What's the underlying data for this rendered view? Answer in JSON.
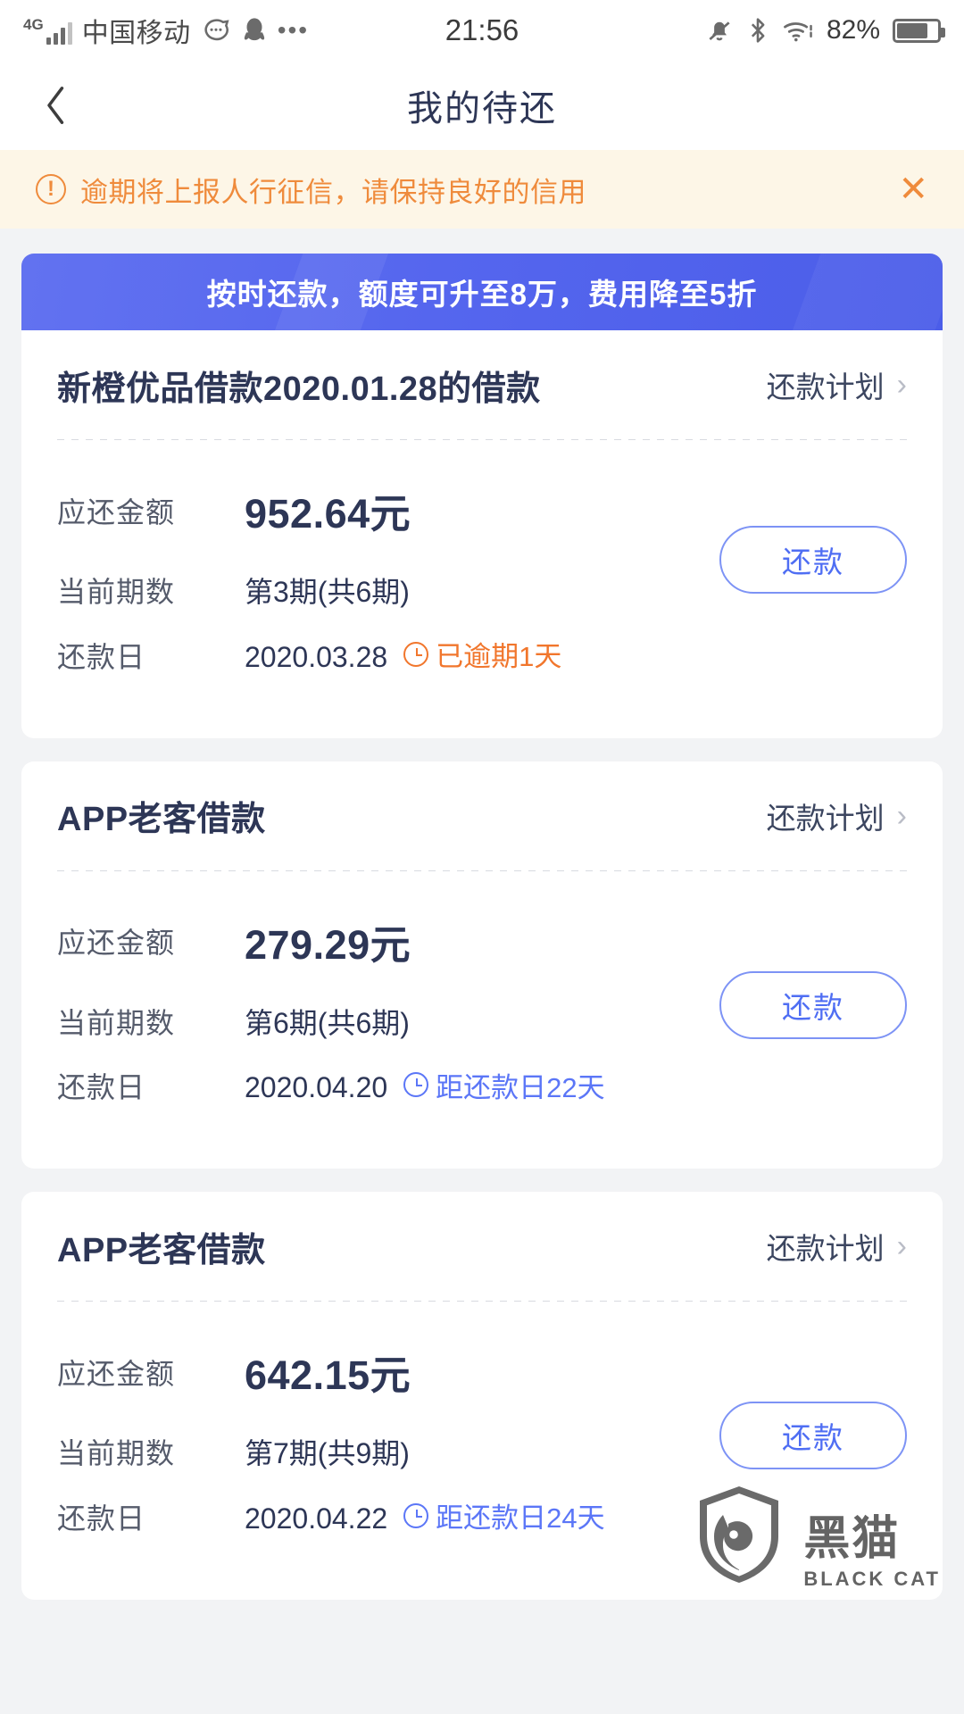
{
  "status_bar": {
    "network_type": "4G",
    "carrier": "中国移动",
    "icons": [
      "chat-bubble-icon",
      "qq-penguin-icon",
      "more-dots-icon",
      "bell-muted-icon",
      "bluetooth-icon",
      "wifi-icon"
    ],
    "time": "21:56",
    "battery_percent": "82%"
  },
  "nav": {
    "back_icon": "chevron-left-icon",
    "title": "我的待还"
  },
  "alert": {
    "icon": "exclamation-circle-icon",
    "text": "逾期将上报人行征信，请保持良好的信用",
    "close_label": "✕",
    "color": "#ef8b3c",
    "background": "#fdf6e7"
  },
  "promo": {
    "text": "按时还款，额度可升至8万，费用降至5折",
    "color": "#5566ee"
  },
  "labels": {
    "plan_link": "还款计划",
    "amount": "应还金额",
    "period": "当前期数",
    "repay_date": "还款日",
    "repay_button": "还款"
  },
  "loans": [
    {
      "title": "新橙优品借款2020.01.28的借款",
      "amount": "952.64元",
      "period": "第3期(共6期)",
      "date": "2020.03.28",
      "status": "已逾期1天",
      "status_type": "overdue",
      "status_color": "#f1762c"
    },
    {
      "title": "APP老客借款",
      "amount": "279.29元",
      "period": "第6期(共6期)",
      "date": "2020.04.20",
      "status": "距还款日22天",
      "status_type": "due",
      "status_color": "#5b76f7"
    },
    {
      "title": "APP老客借款",
      "amount": "642.15元",
      "period": "第7期(共9期)",
      "date": "2020.04.22",
      "status": "距还款日24天",
      "status_type": "due",
      "status_color": "#5b76f7"
    }
  ],
  "watermark": {
    "cn": "黑猫",
    "en": "BLACK CAT",
    "icon": "black-cat-logo-icon"
  }
}
